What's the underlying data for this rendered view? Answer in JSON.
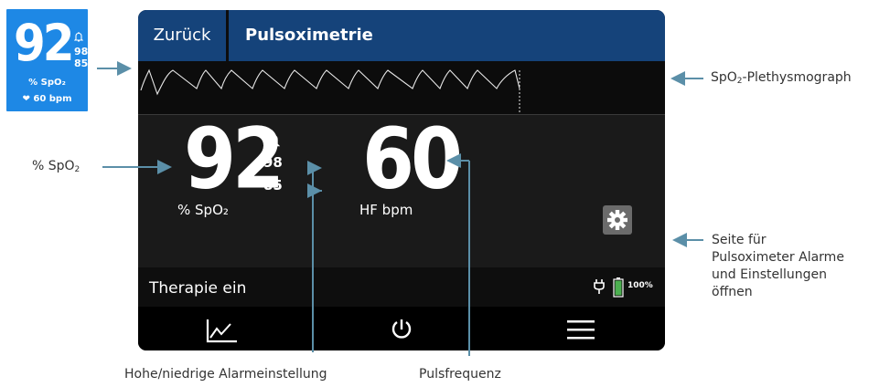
{
  "mini_widget": {
    "spo2_value": "92",
    "high_alarm": "98",
    "low_alarm": "85",
    "spo2_unit": "% SpO₂",
    "heart_rate": "60 bpm",
    "bell_icon": "bell-icon",
    "heart_icon": "heart-icon",
    "color": "#1e88e5"
  },
  "header": {
    "back_label": "Zurück",
    "title": "Pulsoximetrie",
    "color": "#15437a"
  },
  "readings": {
    "spo2_value": "92",
    "spo2_high_alarm": "98",
    "spo2_low_alarm": "85",
    "spo2_unit": "% SpO₂",
    "hr_value": "60",
    "hr_unit": "HF bpm"
  },
  "status": {
    "therapy_label": "Therapie ein",
    "battery_percent": "100%",
    "battery_level": 1.0,
    "battery_color": "#4caf50",
    "plug_icon": "plug-icon"
  },
  "footer": {
    "buttons": [
      "chart-icon",
      "power-icon",
      "menu-icon"
    ]
  },
  "annotations": {
    "pleth_label_main": "SpO",
    "pleth_label_sub": "2",
    "pleth_label_rest": "-Plethysmograph",
    "spo2_label_main": "% SpO",
    "spo2_label_sub": "2",
    "settings_line1": "Seite für",
    "settings_line2": "Pulsoximeter Alarme",
    "settings_line3": "und Einstellungen",
    "settings_line4": "öffnen",
    "alarm_settings": "Hohe/niedrige Alarmeinstellung",
    "pulse_rate": "Pulsfrequenz",
    "arrow_color": "#5b8fa8"
  }
}
